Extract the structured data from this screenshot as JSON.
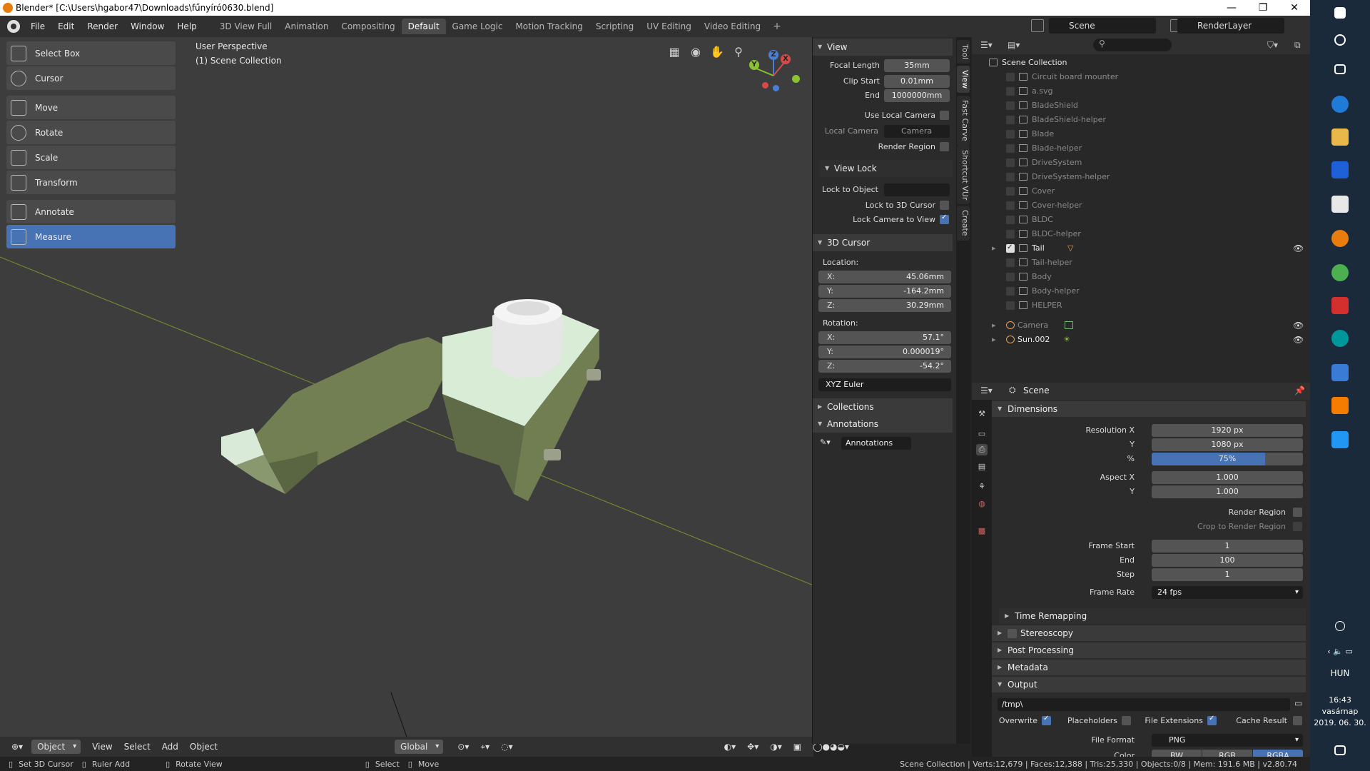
{
  "window": {
    "title": "Blender* [C:\\Users\\hgabor47\\Downloads\\fűnyíró0630.blend]",
    "minimize": "—",
    "maximize": "❐",
    "close": "✕"
  },
  "menu": {
    "items": [
      "File",
      "Edit",
      "Render",
      "Window",
      "Help"
    ],
    "workspaces": [
      "3D View Full",
      "Animation",
      "Compositing",
      "Default",
      "Game Logic",
      "Motion Tracking",
      "Scripting",
      "UV Editing",
      "Video Editing"
    ],
    "add": "+",
    "scene": "Scene",
    "render_layer": "RenderLayer"
  },
  "viewport": {
    "perspective": "User Perspective",
    "collection": "(1) Scene Collection",
    "axis": {
      "x": "X",
      "y": "Y",
      "z": "Z"
    },
    "tools": [
      {
        "label": "Select Box",
        "icon": "select-box-icon",
        "active": false
      },
      {
        "label": "Cursor",
        "icon": "cursor-icon",
        "active": false
      },
      {
        "label": "Move",
        "icon": "move-icon",
        "active": false
      },
      {
        "label": "Rotate",
        "icon": "rotate-icon",
        "active": false
      },
      {
        "label": "Scale",
        "icon": "scale-icon",
        "active": false
      },
      {
        "label": "Transform",
        "icon": "transform-icon",
        "active": false
      },
      {
        "label": "Annotate",
        "icon": "annotate-icon",
        "active": false
      },
      {
        "label": "Measure",
        "icon": "measure-icon",
        "active": true
      }
    ],
    "footer": {
      "mode": "Object Mode",
      "menus": [
        "View",
        "Select",
        "Add",
        "Object"
      ],
      "orientation": "Global"
    }
  },
  "npanel": {
    "tabs": [
      "Tool",
      "View",
      "Fast Carve",
      "Shortcut VUr",
      "Create"
    ],
    "view": {
      "title": "View",
      "focal_length_label": "Focal Length",
      "focal_length": "35mm",
      "clip_start_label": "Clip Start",
      "clip_start": "0.01mm",
      "end_label": "End",
      "end": "1000000mm",
      "use_local_camera": "Use Local Camera",
      "local_camera_label": "Local Camera",
      "local_camera": "Camera",
      "render_region": "Render Region",
      "view_lock": "View Lock",
      "lock_to_object": "Lock to Object",
      "lock_to_cursor": "Lock to 3D Cursor",
      "lock_camera_to_view": "Lock Camera to View"
    },
    "cursor": {
      "title": "3D Cursor",
      "location_label": "Location:",
      "loc_x": "45.06mm",
      "loc_y": "-164.2mm",
      "loc_z": "30.29mm",
      "rotation_label": "Rotation:",
      "rot_x": "57.1°",
      "rot_y": "0.000019°",
      "rot_z": "-54.2°",
      "rotation_mode": "XYZ Euler",
      "x": "X:",
      "y": "Y:",
      "z": "Z:"
    },
    "collections": "Collections",
    "annotations": "Annotations",
    "annotations_field": "Annotations"
  },
  "outliner": {
    "root": "Scene Collection",
    "items": [
      {
        "name": "Circuit board mounter",
        "checked": false
      },
      {
        "name": "a.svg",
        "checked": false
      },
      {
        "name": "BladeShield",
        "checked": false
      },
      {
        "name": "BladeShield-helper",
        "checked": false
      },
      {
        "name": "Blade",
        "checked": false
      },
      {
        "name": "Blade-helper",
        "checked": false
      },
      {
        "name": "DriveSystem",
        "checked": false
      },
      {
        "name": "DriveSystem-helper",
        "checked": false
      },
      {
        "name": "Cover",
        "checked": false
      },
      {
        "name": "Cover-helper",
        "checked": false
      },
      {
        "name": "BLDC",
        "checked": false
      },
      {
        "name": "BLDC-helper",
        "checked": false
      },
      {
        "name": "Tail",
        "checked": true
      },
      {
        "name": "Tail-helper",
        "checked": false
      },
      {
        "name": "Body",
        "checked": false
      },
      {
        "name": "Body-helper",
        "checked": false
      },
      {
        "name": "HELPER",
        "checked": false
      }
    ],
    "objects": [
      {
        "name": "Camera"
      },
      {
        "name": "Sun.002"
      }
    ]
  },
  "properties": {
    "scene": "Scene",
    "dimensions": "Dimensions",
    "res_x_label": "Resolution X",
    "res_x": "1920 px",
    "res_y_label": "Y",
    "res_y": "1080 px",
    "pct_label": "%",
    "pct": "75%",
    "pct_value": 0.75,
    "aspect_x_label": "Aspect X",
    "aspect_x": "1.000",
    "aspect_y_label": "Y",
    "aspect_y": "1.000",
    "render_region": "Render Region",
    "crop": "Crop to Render Region",
    "frame_start_label": "Frame Start",
    "frame_start": "1",
    "frame_end_label": "End",
    "frame_end": "100",
    "step_label": "Step",
    "step": "1",
    "frame_rate_label": "Frame Rate",
    "frame_rate": "24 fps",
    "time_remapping": "Time Remapping",
    "stereoscopy": "Stereoscopy",
    "post_processing": "Post Processing",
    "metadata": "Metadata",
    "output": "Output",
    "output_path": "/tmp\\",
    "overwrite": "Overwrite",
    "placeholders": "Placeholders",
    "file_extensions": "File Extensions",
    "cache_result": "Cache Result",
    "file_format_label": "File Format",
    "file_format": "PNG",
    "color_label": "Color",
    "color_bw": "BW",
    "color_rgb": "RGB",
    "color_rgba": "RGBA"
  },
  "status": {
    "set_cursor": "Set 3D Cursor",
    "ruler_add": "Ruler Add",
    "rotate_view": "Rotate View",
    "select": "Select",
    "move": "Move",
    "stats": "Scene Collection | Verts:12,679 | Faces:12,388 | Tris:25,330 | Objects:0/8 | Mem: 191.6 MB | v2.80.74"
  },
  "taskbar": {
    "lang": "HUN",
    "time": "16:43",
    "day": "vasárnap",
    "date": "2019. 06. 30."
  },
  "colors": {
    "accent": "#4772b3",
    "model": "#7d8a5f",
    "grid_line": "#6f8a2c"
  }
}
